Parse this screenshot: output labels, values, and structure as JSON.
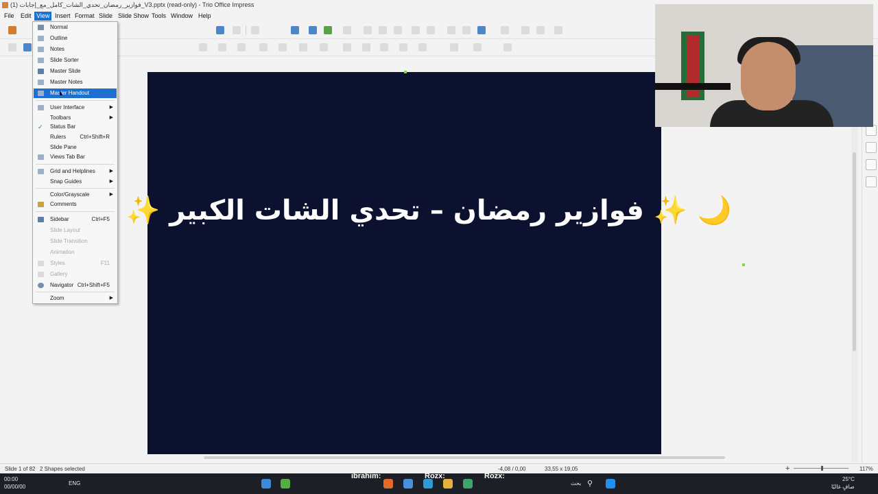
{
  "window": {
    "title": "فوازير_رمضان_تحدي_الشات_كامل_مع_إجابات (1)_V3.pptx (read-only) - Trio Office Impress"
  },
  "menubar": {
    "items": [
      "File",
      "Edit",
      "View",
      "Insert",
      "Format",
      "Slide",
      "Slide Show",
      "Tools",
      "Window",
      "Help"
    ],
    "active": "View"
  },
  "view_menu": {
    "normal": "Normal",
    "outline": "Outline",
    "notes": "Notes",
    "slide_sorter": "Slide Sorter",
    "master_slide": "Master Slide",
    "master_notes": "Master Notes",
    "master_handout": "Master Handout",
    "user_interface": "User Interface",
    "toolbars": "Toolbars",
    "status_bar": "Status Bar",
    "rulers": "Rulers",
    "rulers_shortcut": "Ctrl+Shift+R",
    "slide_pane": "Slide Pane",
    "views_tab_bar": "Views Tab Bar",
    "grid_and_helplines": "Grid and Helplines",
    "snap_guides": "Snap Guides",
    "color_grayscale": "Color/Grayscale",
    "comments": "Comments",
    "sidebar": "Sidebar",
    "sidebar_shortcut": "Ctrl+F5",
    "slide_layout": "Slide Layout",
    "slide_transition": "Slide Transition",
    "animation": "Animation",
    "styles": "Styles",
    "styles_shortcut": "F11",
    "gallery": "Gallery",
    "navigator": "Navigator",
    "navigator_shortcut": "Ctrl+Shift+F5",
    "zoom": "Zoom",
    "highlighted": "Master Handout"
  },
  "slide": {
    "title": "✨ فوازير رمضان – تحدي الشات الكبير ✨ 🌙",
    "background": "#0c1130"
  },
  "statusbar": {
    "slide_info": "Slide 1 of 82",
    "selection": "2 Shapes selected",
    "position": "-4,08 / 0,00",
    "size": "33,55 x 19,05",
    "zoom": "117%"
  },
  "overlay": {
    "name1": "ibrahim:",
    "name2": "Rozx:",
    "name3": "Rozx:"
  },
  "taskbar": {
    "time": "00:00",
    "date": "00/00/00",
    "lang": "ENG",
    "search_placeholder": "بحث",
    "weather_temp": "25°C",
    "weather_desc": "صافٍ غالبًا"
  },
  "colors": {
    "accent": "#1f6fd1",
    "slide_bg": "#0c1130"
  }
}
